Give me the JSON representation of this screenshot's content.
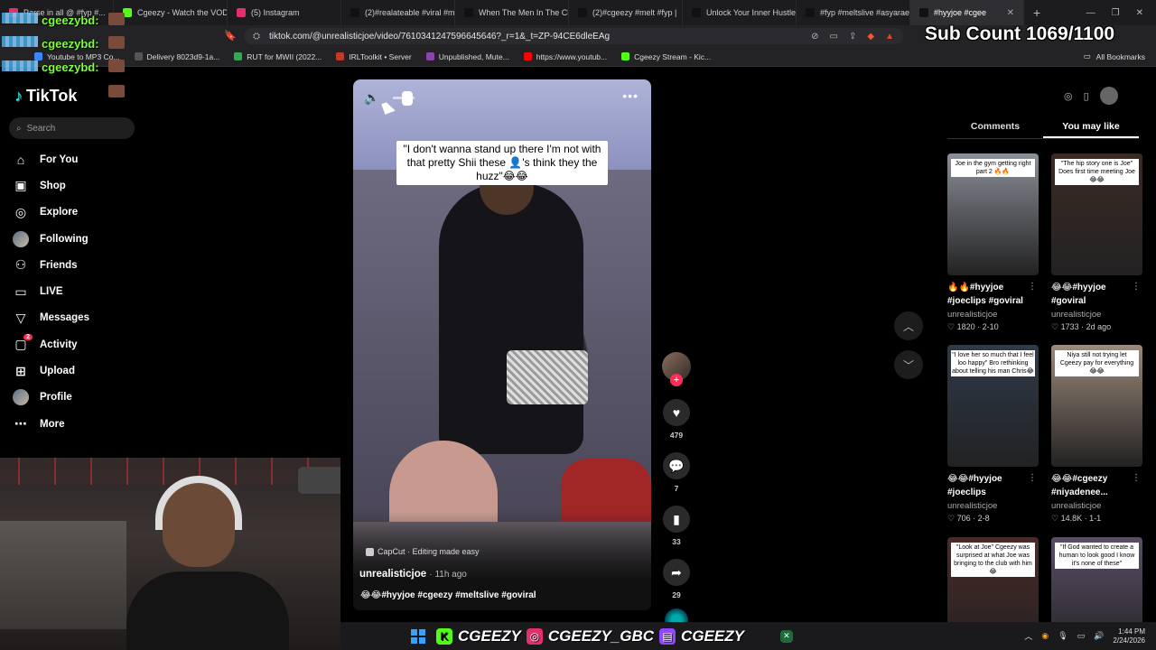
{
  "browser": {
    "tabs": [
      {
        "label": "Parse in all @ #fyp #...",
        "color": "#e1306c"
      },
      {
        "label": "Cgeezy - Watch the VOD",
        "color": "#53fc18"
      },
      {
        "label": "(5) Instagram",
        "color": "#e1306c"
      },
      {
        "label": "(2)#realateable #viral #me",
        "color": "#111"
      },
      {
        "label": "When The Men In The Cl",
        "color": "#111"
      },
      {
        "label": "(2)#cgeezy #melt #fyp |",
        "color": "#111"
      },
      {
        "label": "Unlock Your Inner Hustler",
        "color": "#111"
      },
      {
        "label": "#fyp #meltslive #asyarae",
        "color": "#111"
      },
      {
        "label": "#hyyjoe #cgee",
        "color": "#111",
        "active": true
      }
    ],
    "url": "tiktok.com/@unrealisticjoe/video/7610341247596645646?_r=1&_t=ZP-94CE6dleEAg",
    "bookmarks": [
      {
        "label": "Youtube to MP3 Co...",
        "color": "#3a86ff"
      },
      {
        "label": "Delivery 8023d9-1a...",
        "color": "#555"
      },
      {
        "label": "RUT for MWII (2022...",
        "color": "#34a853"
      },
      {
        "label": "IRLToolkit • Server",
        "color": "#c0392b"
      },
      {
        "label": "Unpublished, Mute...",
        "color": "#8e44ad"
      },
      {
        "label": "https://www.youtub...",
        "color": "#ff0000"
      },
      {
        "label": "Cgeezy Stream - Kic...",
        "color": "#53fc18"
      }
    ],
    "all_bookmarks": "All Bookmarks"
  },
  "overlay": {
    "chat_lines": [
      "cgeezybd:",
      "cgeezybd:",
      "cgeezybd:"
    ],
    "sub_count": "Sub Count 1069/1100"
  },
  "tiktok": {
    "logo": "TikTok",
    "search_placeholder": "Search",
    "nav": [
      {
        "label": "For You",
        "icon": "home-icon",
        "glyph": "⌂"
      },
      {
        "label": "Shop",
        "icon": "shop-icon",
        "glyph": "▣"
      },
      {
        "label": "Explore",
        "icon": "compass-icon",
        "glyph": "◎"
      },
      {
        "label": "Following",
        "icon": "avatar-icon",
        "glyph": ""
      },
      {
        "label": "Friends",
        "icon": "friends-icon",
        "glyph": "⚇"
      },
      {
        "label": "LIVE",
        "icon": "live-icon",
        "glyph": "▭"
      },
      {
        "label": "Messages",
        "icon": "messages-icon",
        "glyph": "▽"
      },
      {
        "label": "Activity",
        "icon": "activity-icon",
        "glyph": "▢",
        "badge": "2"
      },
      {
        "label": "Upload",
        "icon": "upload-icon",
        "glyph": "⊞"
      },
      {
        "label": "Profile",
        "icon": "profile-icon",
        "glyph": ""
      },
      {
        "label": "More",
        "icon": "more-icon",
        "glyph": "⋯"
      }
    ]
  },
  "video": {
    "caption": "\"I don't wanna stand up there I'm not with that pretty Shii these 👤's think they the huzz\"😂😂",
    "capcut": "CapCut · Editing made easy",
    "author": "unrealisticjoe",
    "time": "· 11h ago",
    "tags": "😂😂#hyyjoe #cgeezy #meltslive #goviral",
    "likes": "479",
    "comments": "7",
    "saves": "33",
    "shares": "29"
  },
  "right_panel": {
    "tabs": [
      "Comments",
      "You may like"
    ],
    "cards": [
      {
        "title": "🔥🔥#hyyjoe",
        "title2": "#joeclips #goviral",
        "author": "unrealisticjoe",
        "likes": "1820",
        "date": "2-10",
        "cap": "Joe in the gym getting right part 2 🔥🔥",
        "bg": "#8b8f98"
      },
      {
        "title": "😂😂#hyyjoe",
        "title2": "#goviral",
        "author": "unrealisticjoe",
        "likes": "1733",
        "date": "2d ago",
        "cap": "\"The hip story one is Joe\" Does first time meeting Joe 😂😂",
        "bg": "#3b2a24"
      },
      {
        "title": "😂😂#hyyjoe",
        "title2": "#joeclips",
        "author": "unrealisticjoe",
        "likes": "706",
        "date": "2-8",
        "cap": "\"I love her so much that I feel loo happy\" Bro rethinking about telling his man Chris😂",
        "bg": "#2e3a4a"
      },
      {
        "title": "😂😂#cgeezy",
        "title2": "#niyadenee...",
        "author": "unrealisticjoe",
        "likes": "14.8K",
        "date": "1-1",
        "cap": "Niya still not trying let Cgeezy pay for everything 😂😂",
        "bg": "#9c8a7a"
      },
      {
        "title": "",
        "title2": "",
        "author": "",
        "likes": "",
        "date": "",
        "cap": "\"Look at Joe\" Cgeezy was surprised at what Joe was bringing to the club with him 😂",
        "bg": "#4a2a26"
      },
      {
        "title": "",
        "title2": "",
        "author": "",
        "likes": "",
        "date": "",
        "cap": "\"If God wanted to create a human to look good I know it's none of these\"",
        "bg": "#5a4f66"
      }
    ]
  },
  "taskbar": {
    "handles": [
      "CGEEZY",
      "CGEEZY_GBC",
      "CGEEZY"
    ],
    "time": "1:44 PM",
    "date": "2/24/2026"
  }
}
